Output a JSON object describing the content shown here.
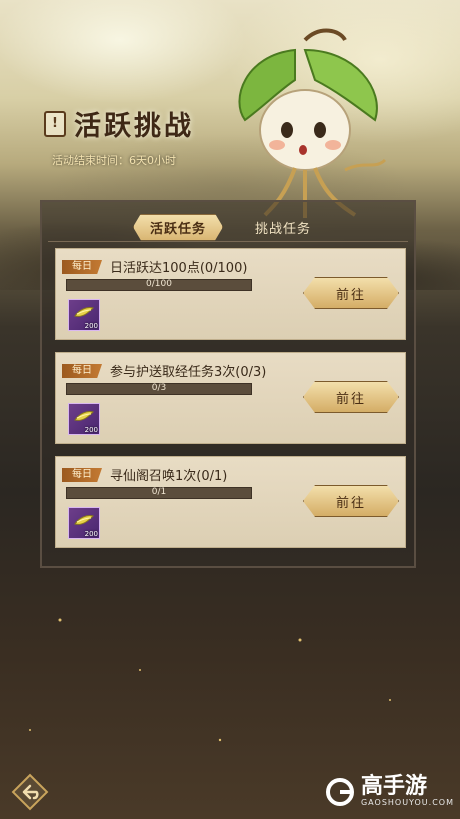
{
  "header": {
    "marker": "!",
    "title": "活跃挑战",
    "subtitle": "活动结束时间：6天0小时"
  },
  "tabs": [
    {
      "label": "活跃任务",
      "active": true
    },
    {
      "label": "挑战任务",
      "active": false
    }
  ],
  "tasks": [
    {
      "badge": "每日",
      "title": "日活跃达100点(0/100)",
      "progress_text": "0/100",
      "progress_fraction": 0,
      "reward_qty": "200",
      "button": "前往"
    },
    {
      "badge": "每日",
      "title": "参与护送取经任务3次(0/3)",
      "progress_text": "0/3",
      "progress_fraction": 0,
      "reward_qty": "200",
      "button": "前往"
    },
    {
      "badge": "每日",
      "title": "寻仙阁召唤1次(0/1)",
      "progress_text": "0/1",
      "progress_fraction": 0,
      "reward_qty": "200",
      "button": "前往"
    }
  ],
  "watermark": {
    "text": "高手游",
    "sub": "GAOSHOUYOU.COM"
  },
  "icons": {
    "back": "back-arrow-icon",
    "reward": "gold-ingot-icon",
    "logo": "gaoshouyou-logo-icon"
  },
  "colors": {
    "accent": "#d4ad66",
    "card": "#e8dcc4",
    "badge": "#9c5a1f",
    "reward_bg": "#6d3e8a"
  }
}
